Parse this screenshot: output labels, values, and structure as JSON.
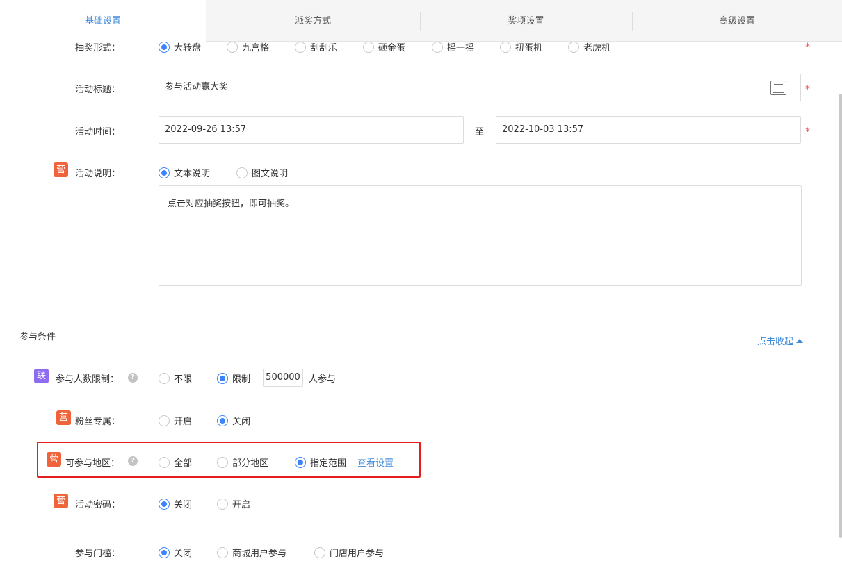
{
  "tabs": [
    "基础设置",
    "派奖方式",
    "奖项设置",
    "高级设置"
  ],
  "draw_form": {
    "label": "抽奖形式：",
    "options": [
      "大转盘",
      "九宫格",
      "刮刮乐",
      "砸金蛋",
      "摇一摇",
      "扭蛋机",
      "老虎机"
    ],
    "selected": "大转盘"
  },
  "title": {
    "label": "活动标题：",
    "value": "参与活动赢大奖",
    "icon": "text-editor-icon"
  },
  "time": {
    "label": "活动时间：",
    "start": "2022-09-26 13:57",
    "separator": "至",
    "end": "2022-10-03 13:57"
  },
  "description": {
    "badge": "营",
    "label": "活动说明：",
    "options": [
      "文本说明",
      "图文说明"
    ],
    "selected": "文本说明",
    "content": "点击对应抽奖按钮，即可抽奖。"
  },
  "required_mark": "*",
  "conditions": {
    "title": "参与条件",
    "collapse_label": "点击收起",
    "limit": {
      "badge": "联",
      "label": "参与人数限制：",
      "options": [
        "不限",
        "限制"
      ],
      "selected": "限制",
      "value": "500000",
      "suffix": "人参与"
    },
    "fans": {
      "badge": "营",
      "label": "粉丝专属：",
      "options": [
        "开启",
        "关闭"
      ],
      "selected": "关闭"
    },
    "region": {
      "badge": "营",
      "label": "可参与地区：",
      "options": [
        "全部",
        "部分地区",
        "指定范围"
      ],
      "selected": "指定范围",
      "link": "查看设置"
    },
    "password": {
      "badge": "营",
      "label": "活动密码：",
      "options": [
        "关闭",
        "开启"
      ],
      "selected": "关闭"
    },
    "threshold": {
      "label": "参与门槛：",
      "options": [
        "关闭",
        "商城用户参与",
        "门店用户参与"
      ],
      "selected": "关闭"
    }
  },
  "colors": {
    "accent": "#3a84ff",
    "link": "#3f8ad9",
    "badge_red": "#f0643c",
    "badge_purple": "#8f6bf0",
    "highlight": "#e41e1e"
  }
}
